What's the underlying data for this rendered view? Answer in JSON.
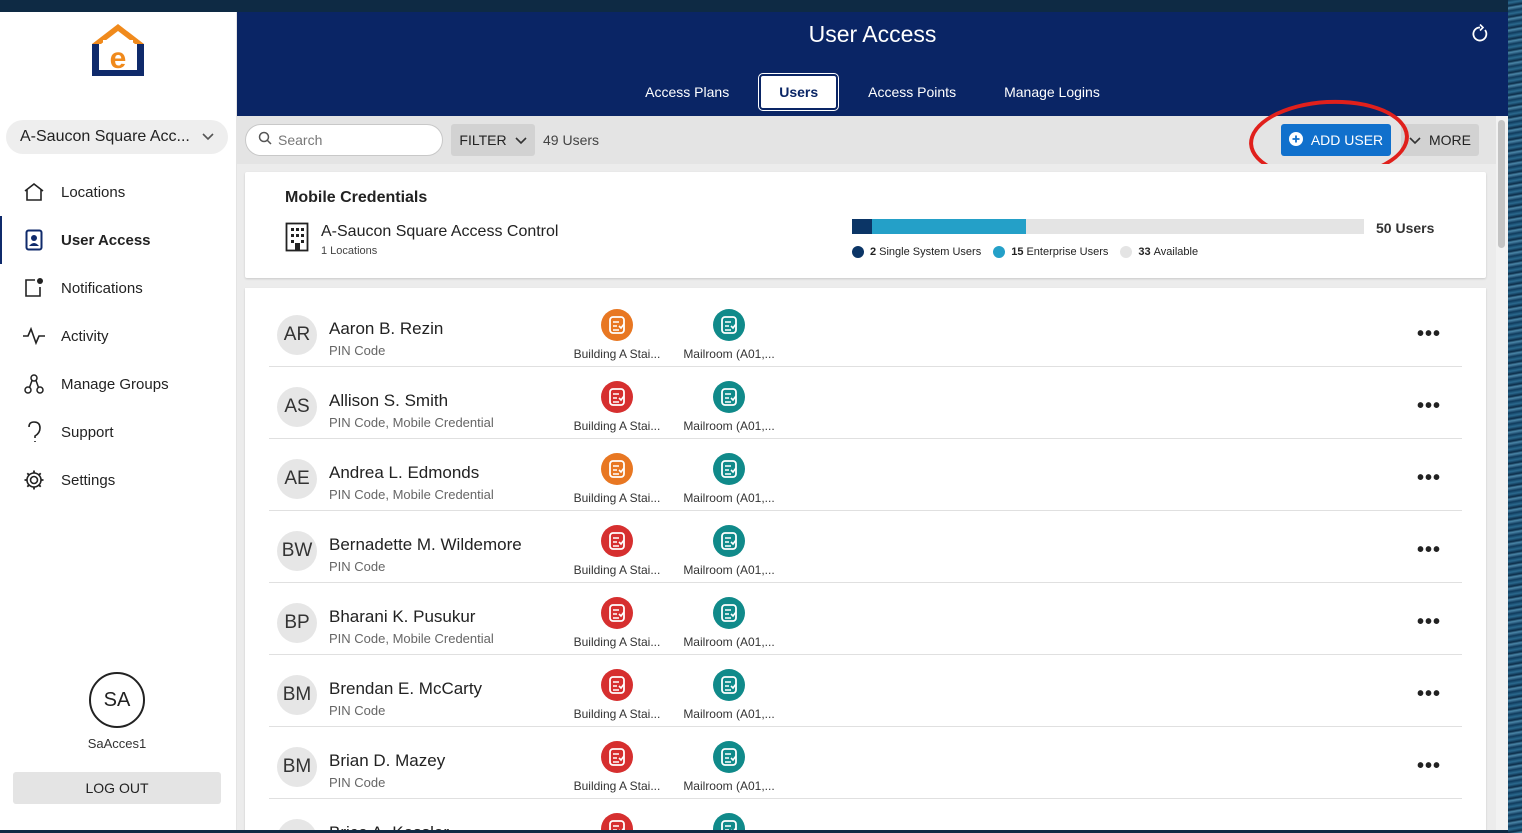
{
  "app": {
    "title": "User Access"
  },
  "colors": {
    "header_bg": "#0a2565",
    "accent": "#1070cc",
    "orange": "#e87722",
    "red": "#d62f2f",
    "teal": "#108a8a"
  },
  "sidebar": {
    "location_select": "A-Saucon Square Acc...",
    "items": [
      {
        "label": "Locations",
        "icon": "home-icon"
      },
      {
        "label": "User Access",
        "icon": "user-badge-icon",
        "active": true
      },
      {
        "label": "Notifications",
        "icon": "notification-icon"
      },
      {
        "label": "Activity",
        "icon": "activity-icon"
      },
      {
        "label": "Manage Groups",
        "icon": "groups-icon"
      },
      {
        "label": "Support",
        "icon": "support-icon"
      },
      {
        "label": "Settings",
        "icon": "gear-icon"
      }
    ],
    "user_initials": "SA",
    "username": "SaAcces1",
    "logout_label": "LOG OUT"
  },
  "tabs": [
    {
      "label": "Access Plans"
    },
    {
      "label": "Users",
      "active": true
    },
    {
      "label": "Access Points"
    },
    {
      "label": "Manage Logins"
    }
  ],
  "toolbar": {
    "search_placeholder": "Search",
    "filter_label": "FILTER",
    "user_count": "49 Users",
    "add_user_label": "ADD USER",
    "more_label": "MORE"
  },
  "mobile_credentials": {
    "title": "Mobile Credentials",
    "org_name": "A-Saucon Square Access Control",
    "locations": "1 Locations",
    "total": "50 Users",
    "single_system": {
      "count": "2",
      "label": "Single System Users",
      "value": 2,
      "color": "#0b3566"
    },
    "enterprise": {
      "count": "15",
      "label": "Enterprise Users",
      "value": 15,
      "color": "#24a0c8"
    },
    "available": {
      "count": "33",
      "label": "Available",
      "value": 33,
      "color": "#e4e4e4"
    },
    "capacity": 50
  },
  "users": [
    {
      "initials": "AR",
      "name": "Aaron B. Rezin",
      "credentials": "PIN Code",
      "ap1": {
        "label": "Building A Stai...",
        "color": "orange"
      },
      "ap2": {
        "label": "Mailroom (A01,...",
        "color": "teal"
      }
    },
    {
      "initials": "AS",
      "name": "Allison S. Smith",
      "credentials": "PIN Code, Mobile Credential",
      "ap1": {
        "label": "Building A Stai...",
        "color": "red"
      },
      "ap2": {
        "label": "Mailroom (A01,...",
        "color": "teal"
      }
    },
    {
      "initials": "AE",
      "name": "Andrea L. Edmonds",
      "credentials": "PIN Code, Mobile Credential",
      "ap1": {
        "label": "Building A Stai...",
        "color": "orange"
      },
      "ap2": {
        "label": "Mailroom (A01,...",
        "color": "teal"
      }
    },
    {
      "initials": "BW",
      "name": "Bernadette M. Wildemore",
      "credentials": "PIN Code",
      "ap1": {
        "label": "Building A Stai...",
        "color": "red"
      },
      "ap2": {
        "label": "Mailroom (A01,...",
        "color": "teal"
      }
    },
    {
      "initials": "BP",
      "name": "Bharani K. Pusukur",
      "credentials": "PIN Code, Mobile Credential",
      "ap1": {
        "label": "Building A Stai...",
        "color": "red"
      },
      "ap2": {
        "label": "Mailroom (A01,...",
        "color": "teal"
      }
    },
    {
      "initials": "BM",
      "name": "Brendan E. McCarty",
      "credentials": "PIN Code",
      "ap1": {
        "label": "Building A Stai...",
        "color": "red"
      },
      "ap2": {
        "label": "Mailroom (A01,...",
        "color": "teal"
      }
    },
    {
      "initials": "BM",
      "name": "Brian D. Mazey",
      "credentials": "PIN Code",
      "ap1": {
        "label": "Building A Stai...",
        "color": "red"
      },
      "ap2": {
        "label": "Mailroom (A01,...",
        "color": "teal"
      }
    },
    {
      "initials": "BK",
      "name": "Brice A. Kessler",
      "credentials": "",
      "ap1": {
        "label": "",
        "color": "red"
      },
      "ap2": {
        "label": "",
        "color": "teal"
      }
    }
  ]
}
